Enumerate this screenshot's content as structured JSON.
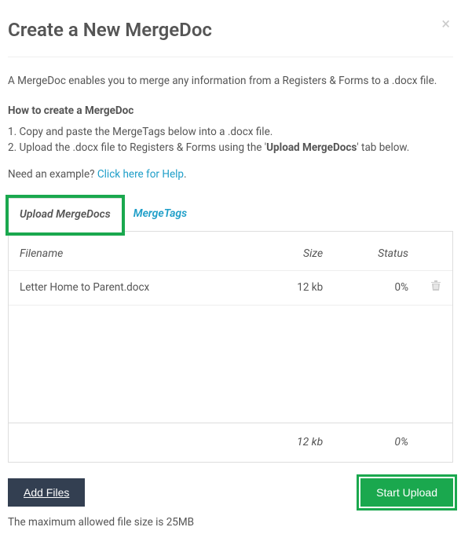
{
  "dialog": {
    "title": "Create a New MergeDoc",
    "intro": "A MergeDoc enables you to merge any information from a Registers & Forms to a .docx file.",
    "howto_title": "How to create a MergeDoc",
    "step1": "1. Copy and paste the MergeTags below into a .docx file.",
    "step2_prefix": "2. Upload the .docx file to Registers & Forms using the '",
    "step2_bold": "Upload MergeDocs",
    "step2_suffix": "' tab below.",
    "example_prefix": "Need an example? ",
    "example_link": "Click here for Help",
    "example_suffix": "."
  },
  "tabs": {
    "upload": "Upload MergeDocs",
    "mergetags": "MergeTags"
  },
  "table": {
    "headers": {
      "filename": "Filename",
      "size": "Size",
      "status": "Status"
    },
    "rows": [
      {
        "filename": "Letter Home to Parent.docx",
        "size": "12 kb",
        "status": "0%"
      }
    ],
    "footer": {
      "size": "12 kb",
      "status": "0%"
    }
  },
  "actions": {
    "add_files": "Add Files",
    "start_upload": "Start Upload"
  },
  "hint": "The maximum allowed file size is 25MB"
}
